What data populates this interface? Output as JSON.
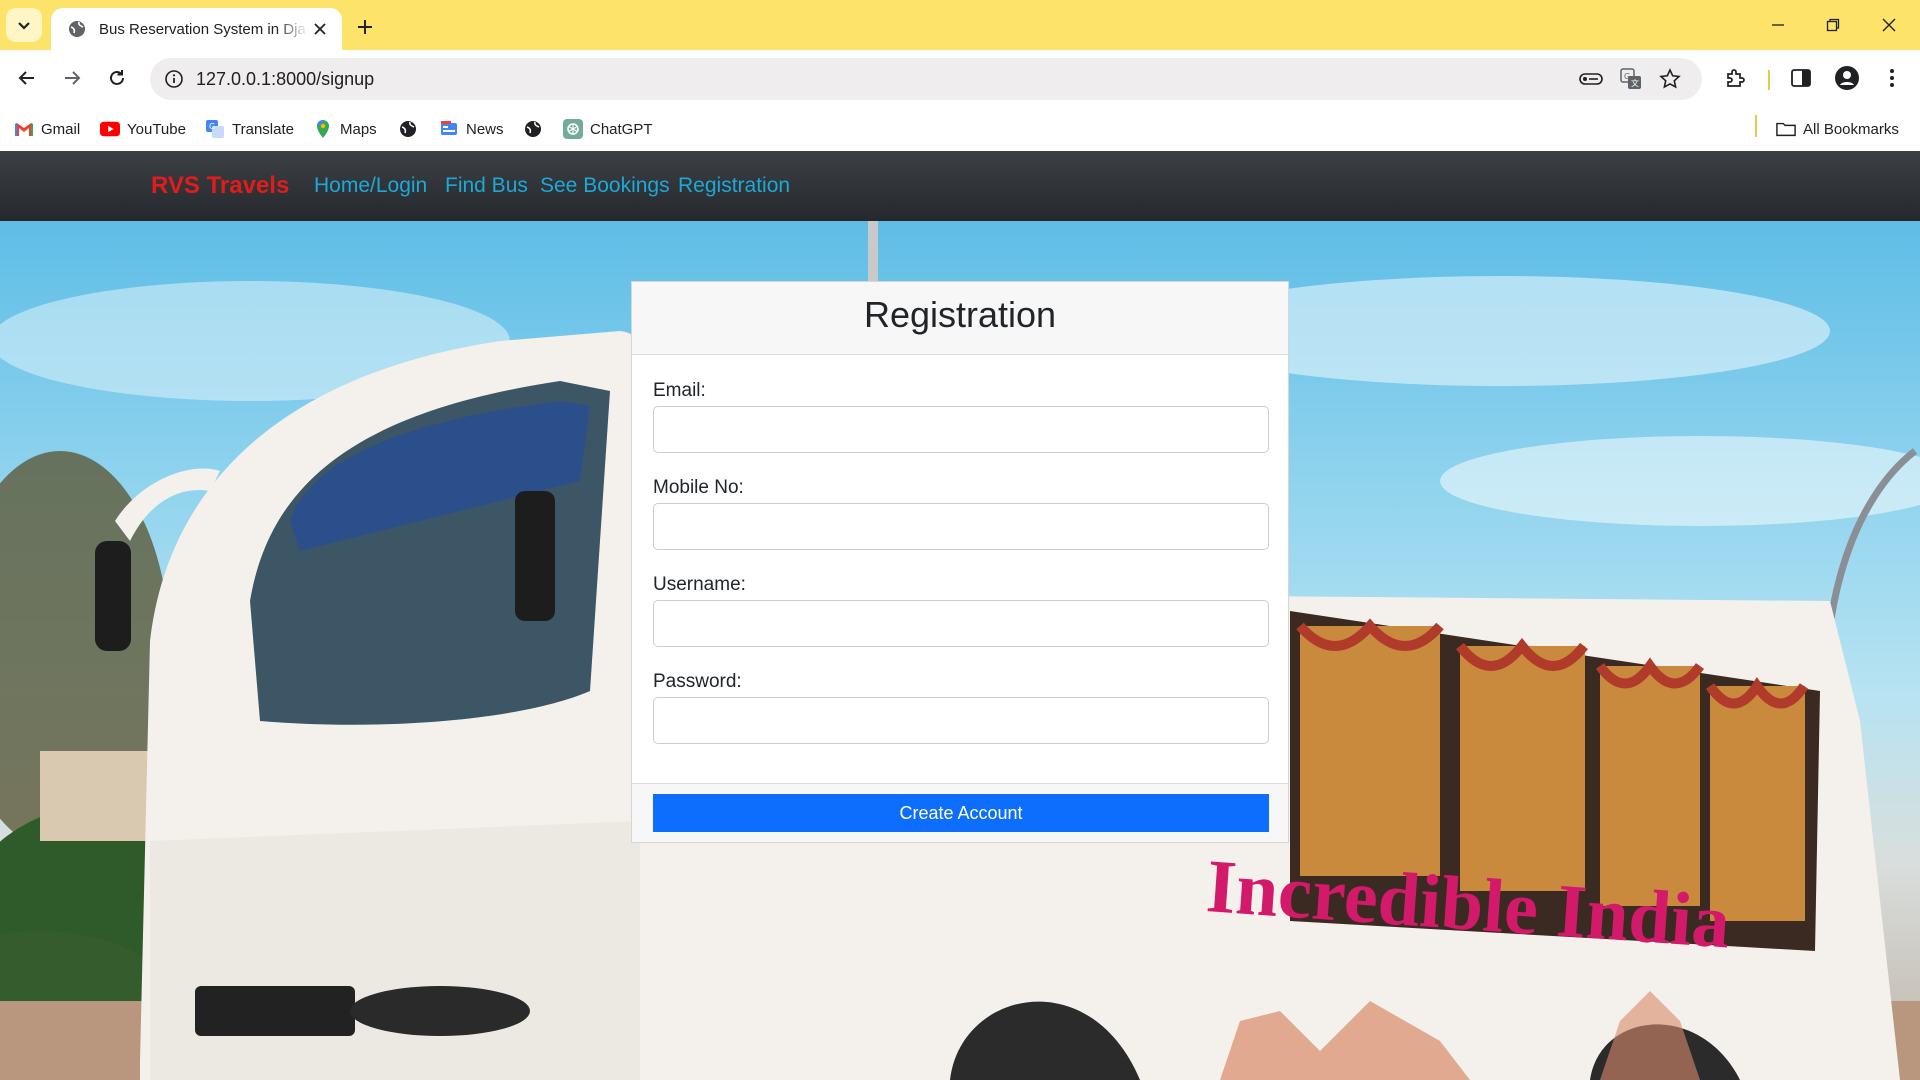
{
  "browser": {
    "tab_title": "Bus Reservation System in Django",
    "url": "127.0.0.1:8000/signup",
    "accent_color": "#fde36a"
  },
  "bookmarks": {
    "items": [
      {
        "label": "Gmail",
        "icon": "gmail-icon"
      },
      {
        "label": "YouTube",
        "icon": "youtube-icon"
      },
      {
        "label": "Translate",
        "icon": "translate-icon"
      },
      {
        "label": "Maps",
        "icon": "maps-icon"
      },
      {
        "label": "",
        "icon": "globe-icon"
      },
      {
        "label": "News",
        "icon": "news-icon"
      },
      {
        "label": "",
        "icon": "globe-icon"
      },
      {
        "label": "ChatGPT",
        "icon": "chatgpt-icon"
      }
    ],
    "all_bookmarks": "All Bookmarks"
  },
  "site": {
    "brand": "RVS Travels",
    "brand_color": "#e21b1b",
    "nav": {
      "home": "Home/Login",
      "find_bus": "Find Bus",
      "see_bookings": "See Bookings",
      "registration": "Registration"
    }
  },
  "form": {
    "title": "Registration",
    "email_label": "Email:",
    "mobile_label": "Mobile No:",
    "username_label": "Username:",
    "password_label": "Password:",
    "email_value": "",
    "mobile_value": "",
    "username_value": "",
    "password_value": "",
    "submit_label": "Create Account",
    "submit_color": "#0d6efd"
  },
  "background": {
    "bus_text": "Incredible India"
  }
}
